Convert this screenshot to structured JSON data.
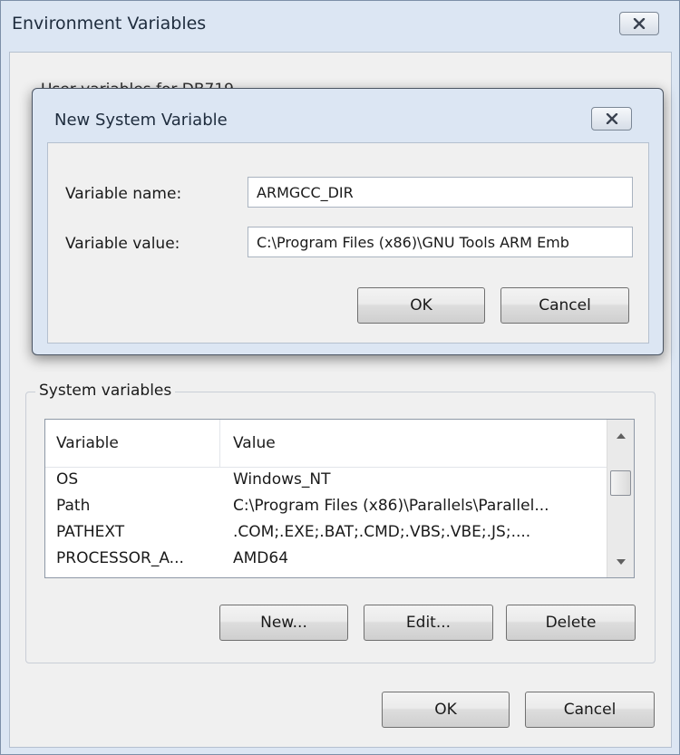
{
  "window": {
    "title": "Environment Variables",
    "user_section_heading": "User variables for DB719"
  },
  "dialog": {
    "title": "New System Variable",
    "name_label": "Variable name:",
    "value_label": "Variable value:",
    "name_value": "ARMGCC_DIR",
    "value_value": "C:\\Program Files (x86)\\GNU Tools ARM Emb",
    "ok_label": "OK",
    "cancel_label": "Cancel"
  },
  "system": {
    "label": "System variables",
    "columns": [
      "Variable",
      "Value"
    ],
    "rows": [
      {
        "variable": "OS",
        "value": "Windows_NT"
      },
      {
        "variable": "Path",
        "value": "C:\\Program Files (x86)\\Parallels\\Parallel..."
      },
      {
        "variable": "PATHEXT",
        "value": ".COM;.EXE;.BAT;.CMD;.VBS;.VBE;.JS;...."
      },
      {
        "variable": "PROCESSOR_A...",
        "value": "AMD64"
      }
    ],
    "new_label": "New...",
    "edit_label": "Edit...",
    "delete_label": "Delete"
  },
  "footer": {
    "ok_label": "OK",
    "cancel_label": "Cancel"
  }
}
